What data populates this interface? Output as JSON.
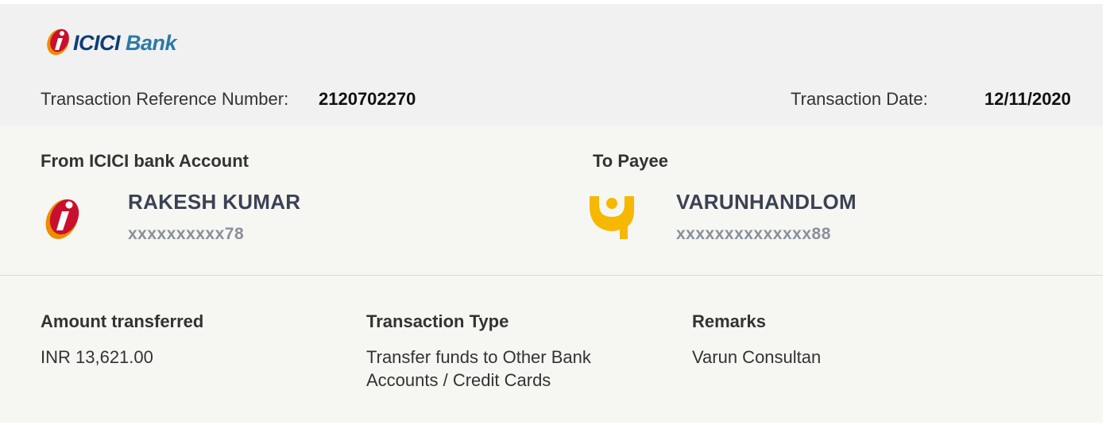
{
  "header": {
    "logo_text": "ICICI",
    "logo_bank": "Bank",
    "ref_label": "Transaction Reference Number:",
    "ref_value": "2120702270",
    "date_label": "Transaction Date:",
    "date_value": "12/11/2020"
  },
  "from": {
    "title": "From ICICI bank Account",
    "name": "RAKESH KUMAR",
    "account": "xxxxxxxxxx78",
    "icon": "icici-logo-icon"
  },
  "to": {
    "title": "To Payee",
    "name": "VARUNHANDLOM",
    "account": "xxxxxxxxxxxxxx88",
    "icon": "pnb-logo-icon"
  },
  "details": {
    "amount_title": "Amount transferred",
    "amount_value": "INR 13,621.00",
    "type_title": "Transaction Type",
    "type_value": "Transfer funds to Other Bank Accounts / Credit Cards",
    "remarks_title": "Remarks",
    "remarks_value": "Varun Consultan"
  },
  "colors": {
    "icici_red": "#c8102e",
    "icici_orange": "#f08c00",
    "icici_blue": "#0d3d7a",
    "pnb_yellow": "#f6b800"
  }
}
